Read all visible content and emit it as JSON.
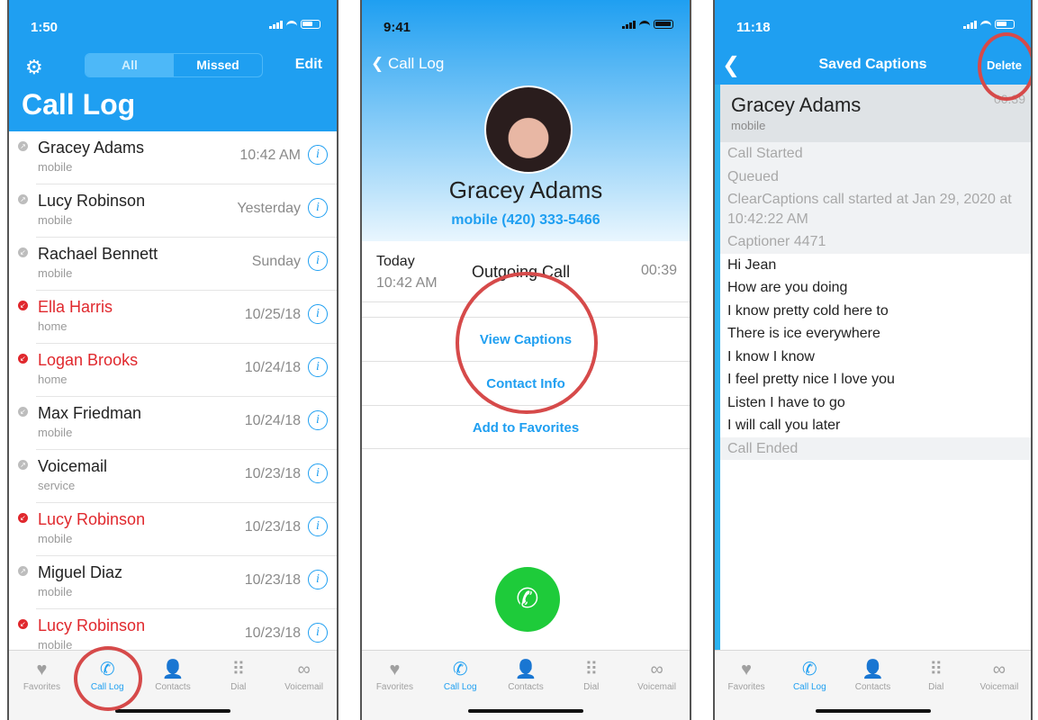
{
  "phone1": {
    "status": {
      "time": "1:50"
    },
    "segments": [
      "All",
      "Missed"
    ],
    "edit_label": "Edit",
    "title": "Call Log",
    "calls": [
      {
        "name": "Gracey Adams",
        "type": "mobile",
        "time": "10:42 AM",
        "missed": false
      },
      {
        "name": "Lucy Robinson",
        "type": "mobile",
        "time": "Yesterday",
        "missed": false
      },
      {
        "name": "Rachael Bennett",
        "type": "mobile",
        "time": "Sunday",
        "missed": false
      },
      {
        "name": "Ella Harris",
        "type": "home",
        "time": "10/25/18",
        "missed": true
      },
      {
        "name": "Logan Brooks",
        "type": "home",
        "time": "10/24/18",
        "missed": true
      },
      {
        "name": "Max Friedman",
        "type": "mobile",
        "time": "10/24/18",
        "missed": false
      },
      {
        "name": "Voicemail",
        "type": "service",
        "time": "10/23/18",
        "missed": false
      },
      {
        "name": "Lucy Robinson",
        "type": "mobile",
        "time": "10/23/18",
        "missed": true
      },
      {
        "name": "Miguel Diaz",
        "type": "mobile",
        "time": "10/23/18",
        "missed": false
      },
      {
        "name": "Lucy Robinson",
        "type": "mobile",
        "time": "10/23/18",
        "missed": true
      }
    ]
  },
  "phone2": {
    "status": {
      "time": "9:41"
    },
    "back_label": "Call Log",
    "contact_name": "Gracey Adams",
    "number": "mobile (420) 333-5466",
    "call": {
      "day": "Today",
      "time": "10:42 AM",
      "type": "Outgoing Call",
      "duration": "00:39"
    },
    "actions": [
      "View Captions",
      "Contact Info",
      "Add to Favorites"
    ]
  },
  "phone3": {
    "status": {
      "time": "11:18"
    },
    "title": "Saved Captions",
    "delete_label": "Delete",
    "name": "Gracey Adams",
    "sub": "mobile",
    "duration": "00:39",
    "lines": [
      {
        "text": "Call Started",
        "sys": true
      },
      {
        "text": "Queued",
        "sys": true
      },
      {
        "text": "ClearCaptions call started at Jan 29, 2020 at 10:42:22 AM",
        "sys": true
      },
      {
        "text": "Captioner 4471",
        "sys": true
      },
      {
        "text": "Hi Jean",
        "sys": false
      },
      {
        "text": "How are you doing",
        "sys": false
      },
      {
        "text": "I know pretty cold here to",
        "sys": false
      },
      {
        "text": "There is ice everywhere",
        "sys": false
      },
      {
        "text": "I know I know",
        "sys": false
      },
      {
        "text": "I feel pretty nice I love you",
        "sys": false
      },
      {
        "text": "Listen I have to go",
        "sys": false
      },
      {
        "text": "I will call you later",
        "sys": false
      },
      {
        "text": "Call Ended",
        "sys": true
      }
    ]
  },
  "tabs": [
    {
      "label": "Favorites",
      "icon": "heart-icon"
    },
    {
      "label": "Call Log",
      "icon": "call-log-icon"
    },
    {
      "label": "Contacts",
      "icon": "person-icon"
    },
    {
      "label": "Dial",
      "icon": "keypad-icon"
    },
    {
      "label": "Voicemail",
      "icon": "voicemail-icon"
    }
  ],
  "colors": {
    "accent": "#1f9ff1",
    "missed": "#e0282d",
    "highlight_ring": "#d64a4a",
    "call_button": "#1ecb3a"
  }
}
